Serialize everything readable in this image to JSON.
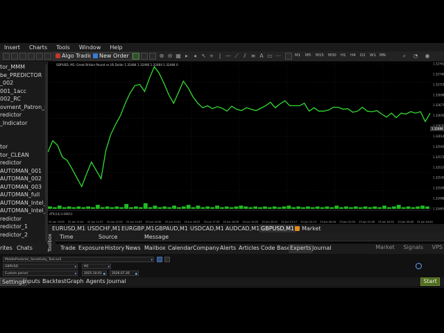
{
  "menu": [
    "Insert",
    "Charts",
    "Tools",
    "Window",
    "Help"
  ],
  "toolbar": {
    "algo_trading": "Algo Trading",
    "new_order": "New Order",
    "timeframes": [
      "M1",
      "M5",
      "M15",
      "M30",
      "H1",
      "H4",
      "D1",
      "W1",
      "MN"
    ]
  },
  "sidebar": {
    "items": [
      "tor_MMM",
      "be_PREDICTOR",
      "_002",
      "001_1acc",
      "002_RC",
      "ovment_Patron_LA",
      "redictor",
      "_Indicator",
      "",
      "tor",
      "tor_CLEAN",
      "redictor",
      "AUTOMAN_001",
      "AUTOMAN_002",
      "AUTOMAN_003",
      "AUTOMAN_full",
      "AUTOMAN_Intel_2p",
      "AUTOMAN_Intel_Av",
      "redictor",
      "redictor_1",
      "redictor_2"
    ],
    "tabs": [
      "rites",
      "Chats"
    ]
  },
  "chart": {
    "header": "GBPUSD, M1:  Great Britain Pound vs US Dollar  1.32484 1.32490 1.32484 1.32484 0",
    "indicator_label": "ATR(14) 0.00011",
    "price_labels": [
      "1.32761",
      "1.32740",
      "1.32719",
      "1.32698",
      "1.32677",
      "1.32656",
      "1.32635",
      "1.32614",
      "1.32593",
      "1.32572",
      "1.32551",
      "1.32530",
      "1.32509",
      "1.32488",
      "1.32467"
    ],
    "current_price": "1.32484",
    "time_labels": [
      "22 Jun 10:05",
      "22 Jun 11:01",
      "22 Jun 11:57",
      "22 Jun 12:53",
      "22 Jun 13:49",
      "22 Jun 14:45",
      "22 Jun 15:41",
      "22 Jun 16:37",
      "22 Jun 17:33",
      "22 Jun 18:29",
      "22 Jun 19:25",
      "22 Jun 20:21",
      "22 Jun 21:17",
      "22 Jun 22:13",
      "23 Jun 00:04",
      "23 Jun 01:00",
      "23 Jun 01:56",
      "23 Jun 02:52",
      "23 Jun 03:48",
      "23 Jun 04:44"
    ],
    "line_color": "#33dd33",
    "volume_color": "#22bb22"
  },
  "chart_data": {
    "type": "line",
    "title": "GBPUSD, M1",
    "ylim": [
      1.32467,
      1.32761
    ],
    "series": [
      {
        "name": "GBPUSD",
        "values": [
          1.32582,
          1.32605,
          1.32596,
          1.32572,
          1.32565,
          1.32548,
          1.3253,
          1.32512,
          1.32538,
          1.32562,
          1.32545,
          1.32528,
          1.32586,
          1.32618,
          1.32638,
          1.32656,
          1.32681,
          1.32702,
          1.32717,
          1.32719,
          1.32705,
          1.32732,
          1.32755,
          1.32742,
          1.32721,
          1.32698,
          1.32681,
          1.32703,
          1.32726,
          1.32712,
          1.32694,
          1.32681,
          1.32672,
          1.32676,
          1.3267,
          1.32674,
          1.32671,
          1.32665,
          1.32675,
          1.32669,
          1.32666,
          1.32672,
          1.32669,
          1.32666,
          1.32671,
          1.32676,
          1.32683,
          1.32672,
          1.3268,
          1.32686,
          1.32676,
          1.32676,
          1.32676,
          1.32681,
          1.32665,
          1.32672,
          1.32665,
          1.32665,
          1.32667,
          1.32673,
          1.32673,
          1.32669,
          1.3267,
          1.32663,
          1.32665,
          1.32673,
          1.32665,
          1.32664,
          1.32666,
          1.32659,
          1.32653,
          1.32661,
          1.32652,
          1.32661,
          1.32659,
          1.32664,
          1.32661,
          1.32664,
          1.32644,
          1.32661
        ]
      },
      {
        "name": "Volume",
        "values": [
          3,
          2,
          4,
          2,
          3,
          2,
          3,
          2,
          3,
          2,
          5,
          2,
          3,
          2,
          3,
          2,
          6,
          2,
          3,
          2,
          7,
          2,
          4,
          2,
          3,
          2,
          4,
          2,
          3,
          5,
          2,
          4,
          2,
          3,
          2,
          4,
          2,
          3,
          2,
          3,
          4,
          3,
          2,
          3,
          2,
          3,
          2,
          3,
          2,
          3,
          4,
          2,
          3,
          2,
          3,
          2,
          3,
          2,
          3,
          2,
          4,
          2,
          3,
          2,
          3,
          2,
          3,
          2,
          3,
          2,
          4,
          2,
          3,
          5,
          2,
          3,
          2,
          3,
          4,
          3
        ]
      }
    ]
  },
  "symbol_tabs": [
    "EURUSD,M1",
    "USDCHF,M1",
    "EURGBP,M1",
    "GBPAUD,M1",
    "USDCAD,M1",
    "AUDCAD,M1",
    "GBPUSD,M1",
    "Market"
  ],
  "toolbox": {
    "label": "Toolbox",
    "columns": [
      "Time",
      "Source",
      "Message"
    ],
    "tabs": [
      "Trade",
      "Exposure",
      "History",
      "News",
      "Mailbox",
      "Calendar",
      "Company",
      "Alerts",
      "Articles",
      "Code Base",
      "Experts",
      "Journal"
    ],
    "right_links": [
      "Market",
      "Signals",
      "VPS"
    ]
  },
  "tester": {
    "expert": "MiddlePredictor_Sensitivity_Test.ex5",
    "symbol": "GBPUSD",
    "timeframe": "M1",
    "period": "Custom period",
    "date_from": "2025.10.01",
    "date_to": "2026.07.26",
    "tabs": [
      "Settings",
      "Inputs",
      "Backtest",
      "Graph",
      "Agents",
      "Journal"
    ],
    "start": "Start"
  }
}
